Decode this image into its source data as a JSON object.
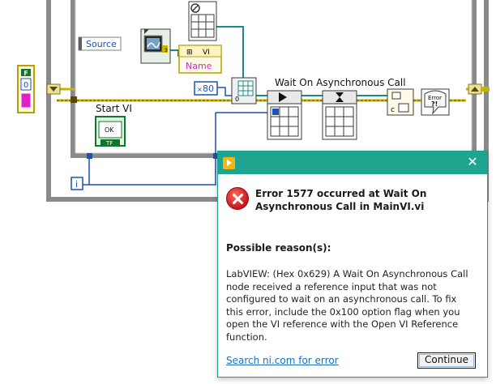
{
  "diagram": {
    "source_label": "Source",
    "name_label": "Name",
    "constant_label": "80",
    "constant_prefix": "×",
    "wait_label": "Wait On Asynchronous Call",
    "start_vi_label": "Start VI",
    "ok_button_label": "OK",
    "tf_label": "TF",
    "bool_control_label": "F",
    "numeric_value": "0",
    "iteration_label": "i",
    "vi_ref_label": "VI",
    "option_label": "0",
    "error_glyph": "Error",
    "error_glyph2": "?!"
  },
  "dialog": {
    "title": "Error 1577 occurred at Wait On Asynchronous Call in MainVI.vi",
    "title_line1": "Error 1577 occurred at Wait On",
    "title_line2": "Asynchronous Call in MainVI.vi",
    "reason_heading": "Possible reason(s):",
    "reason_lines": [
      "LabVIEW: (Hex 0x629) A Wait On Asynchronous Call",
      "node received a reference input that was not",
      "configured to wait on an asynchronous call. To fix",
      "this error, include the 0x100 option flag when you",
      "open the VI reference with the Open VI Reference",
      "function."
    ],
    "search_link": "Search ni.com for error",
    "continue_button": "Continue",
    "close_icon": "close-icon",
    "app_icon": "labview-app-icon",
    "error_icon": "error-x-icon"
  },
  "colors": {
    "titlebar": "#1fa58f",
    "wire_ref": "#1f4fb8",
    "wire_error": "#b8a000",
    "wire_teal": "#1a8a8a",
    "structure_frame": "#808080"
  }
}
